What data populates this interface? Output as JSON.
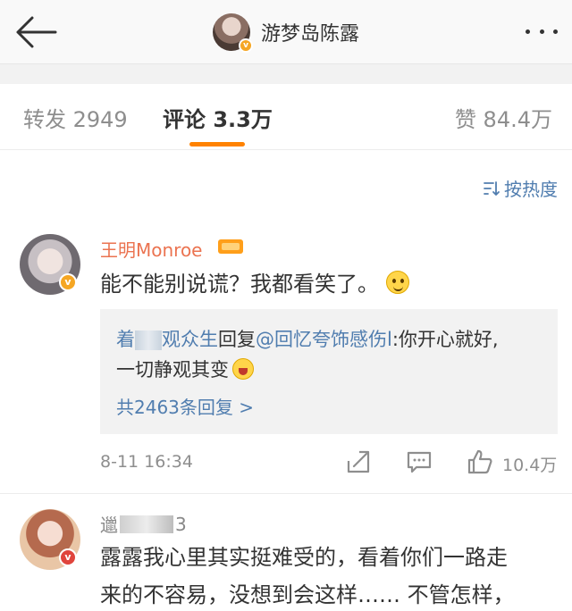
{
  "header": {
    "title": "游梦岛陈露",
    "badge": "v"
  },
  "tabs": [
    {
      "label": "转发 2949"
    },
    {
      "label": "评论 3.3万"
    },
    {
      "label": "赞 84.4万"
    }
  ],
  "sort": {
    "label": "按热度"
  },
  "comments": [
    {
      "username": "王明Monroe",
      "badge": "v",
      "text": "能不能别说谎？我都看笑了。",
      "reply": {
        "author_prefix": "着",
        "author_suffix": "观众生",
        "action": "回复",
        "mention": "@回忆夸饰感伤l",
        "text_line1": ":你开心就好,",
        "text_line2": "一切静观其变",
        "more": "共2463条回复 >"
      },
      "time": "8-11 16:34",
      "likes": "10.4万"
    },
    {
      "username_prefix": "邋",
      "username_suffix": "3",
      "badge": "v",
      "text_line1": "露露我心里其实挺难受的，看着你们一路走",
      "text_line2": "来的不容易，没想到会这样…… 不管怎样，"
    }
  ],
  "colors": {
    "accent": "#ff8200",
    "link": "#507daf",
    "username": "#eb7350",
    "muted": "#8e8e8e"
  }
}
